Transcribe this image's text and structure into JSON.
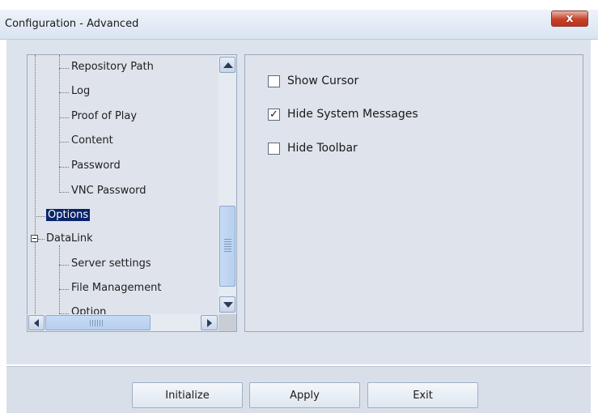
{
  "window": {
    "title": "Configuration - Advanced",
    "close_label": "x"
  },
  "tree": {
    "items": [
      {
        "label": "Repository Path",
        "level": 2
      },
      {
        "label": "Log",
        "level": 2
      },
      {
        "label": "Proof of Play",
        "level": 2
      },
      {
        "label": "Content",
        "level": 2
      },
      {
        "label": "Password",
        "level": 2
      },
      {
        "label": "VNC Password",
        "level": 2
      },
      {
        "label": "Options",
        "level": 1,
        "selected": true
      },
      {
        "label": "DataLink",
        "level": 1,
        "expanded": true
      },
      {
        "label": "Server settings",
        "level": 2
      },
      {
        "label": "File Management",
        "level": 2
      },
      {
        "label": "Option",
        "level": 2,
        "partially_visible": true
      }
    ]
  },
  "options": [
    {
      "label": "Show Cursor",
      "checked": false
    },
    {
      "label": "Hide System Messages",
      "checked": true
    },
    {
      "label": "Hide Toolbar",
      "checked": false
    }
  ],
  "buttons": {
    "initialize": "Initialize",
    "apply": "Apply",
    "exit": "Exit"
  },
  "colors": {
    "selection": "#0a246a",
    "panel_bg": "#dfe4ec",
    "close_button": "#c7402a"
  }
}
